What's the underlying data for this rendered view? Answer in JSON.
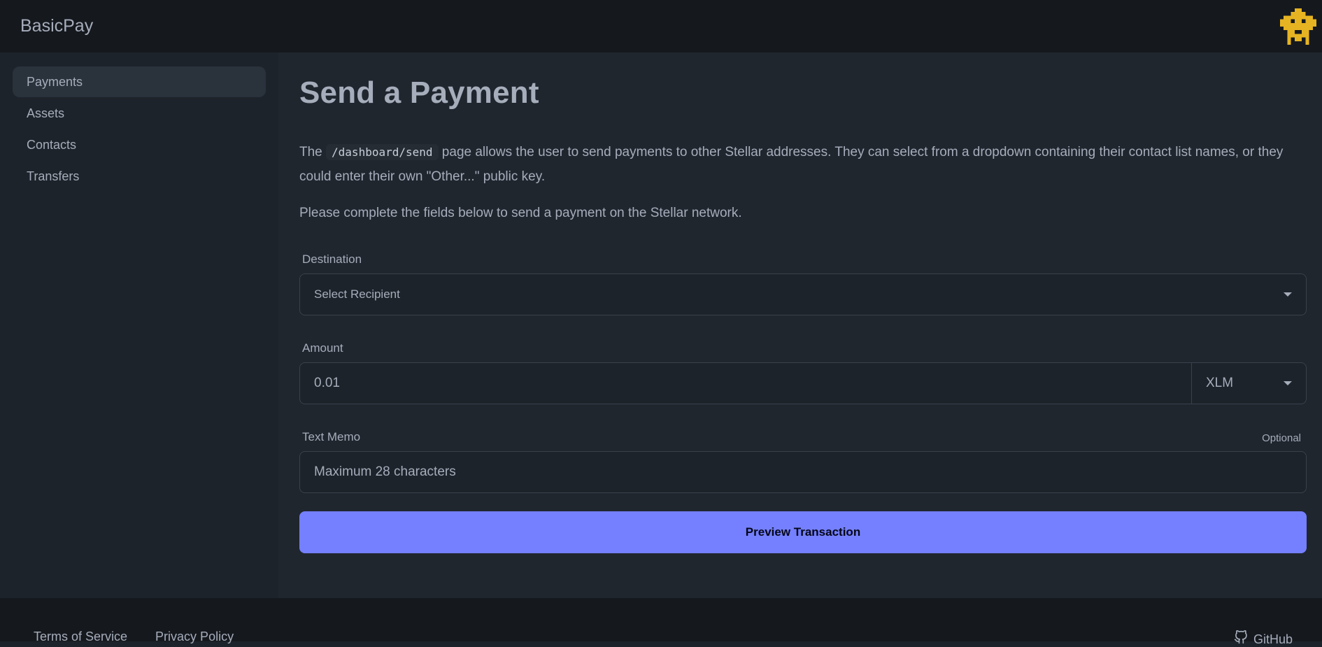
{
  "app": {
    "brand": "BasicPay"
  },
  "sidebar": {
    "items": [
      {
        "label": "Payments",
        "active": true
      },
      {
        "label": "Assets",
        "active": false
      },
      {
        "label": "Contacts",
        "active": false
      },
      {
        "label": "Transfers",
        "active": false
      }
    ]
  },
  "main": {
    "title": "Send a Payment",
    "desc_prefix": "The ",
    "desc_code": "/dashboard/send",
    "desc_suffix": " page allows the user to send payments to other Stellar addresses. They can select from a dropdown containing their contact list names, or they could enter their own \"Other...\" public key.",
    "desc2": "Please complete the fields below to send a payment on the Stellar network."
  },
  "form": {
    "destination_label": "Destination",
    "destination_value": "Select Recipient",
    "amount_label": "Amount",
    "amount_value": "0.01",
    "asset_value": "XLM",
    "memo_label": "Text Memo",
    "memo_optional": "Optional",
    "memo_placeholder": "Maximum 28 characters",
    "submit_label": "Preview Transaction"
  },
  "footer": {
    "terms": "Terms of Service",
    "privacy": "Privacy Policy",
    "github": "GitHub"
  },
  "colors": {
    "accent": "#7480ff",
    "avatar": "#e6b422"
  }
}
